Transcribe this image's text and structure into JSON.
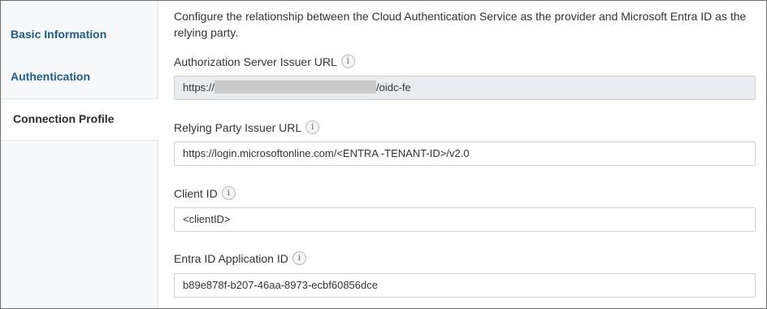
{
  "sidebar": {
    "items": [
      {
        "label": "Basic Information"
      },
      {
        "label": "Authentication"
      },
      {
        "label": "Connection Profile"
      }
    ]
  },
  "main": {
    "intro": "Configure the relationship between the Cloud Authentication Service as the provider and Microsoft Entra ID as the relying party.",
    "fields": {
      "auth_server": {
        "label": "Authorization Server Issuer URL",
        "value_prefix": "https://",
        "value_suffix": "/oidc-fe"
      },
      "relying_party": {
        "label": "Relying Party Issuer URL",
        "value": "https://login.microsoftonline.com/<ENTRA -TENANT-ID>/v2.0"
      },
      "client_id": {
        "label": "Client ID",
        "value": "<clientID>"
      },
      "entra_app_id": {
        "label": "Entra ID Application ID",
        "value": "b89e878f-b207-46aa-8973-ecbf60856dce"
      }
    },
    "info_icon_glyph": "i"
  },
  "colors": {
    "link": "#1f5f8a",
    "readonly_bg": "#e9ecee",
    "sidebar_bg": "#f7f8f9"
  }
}
